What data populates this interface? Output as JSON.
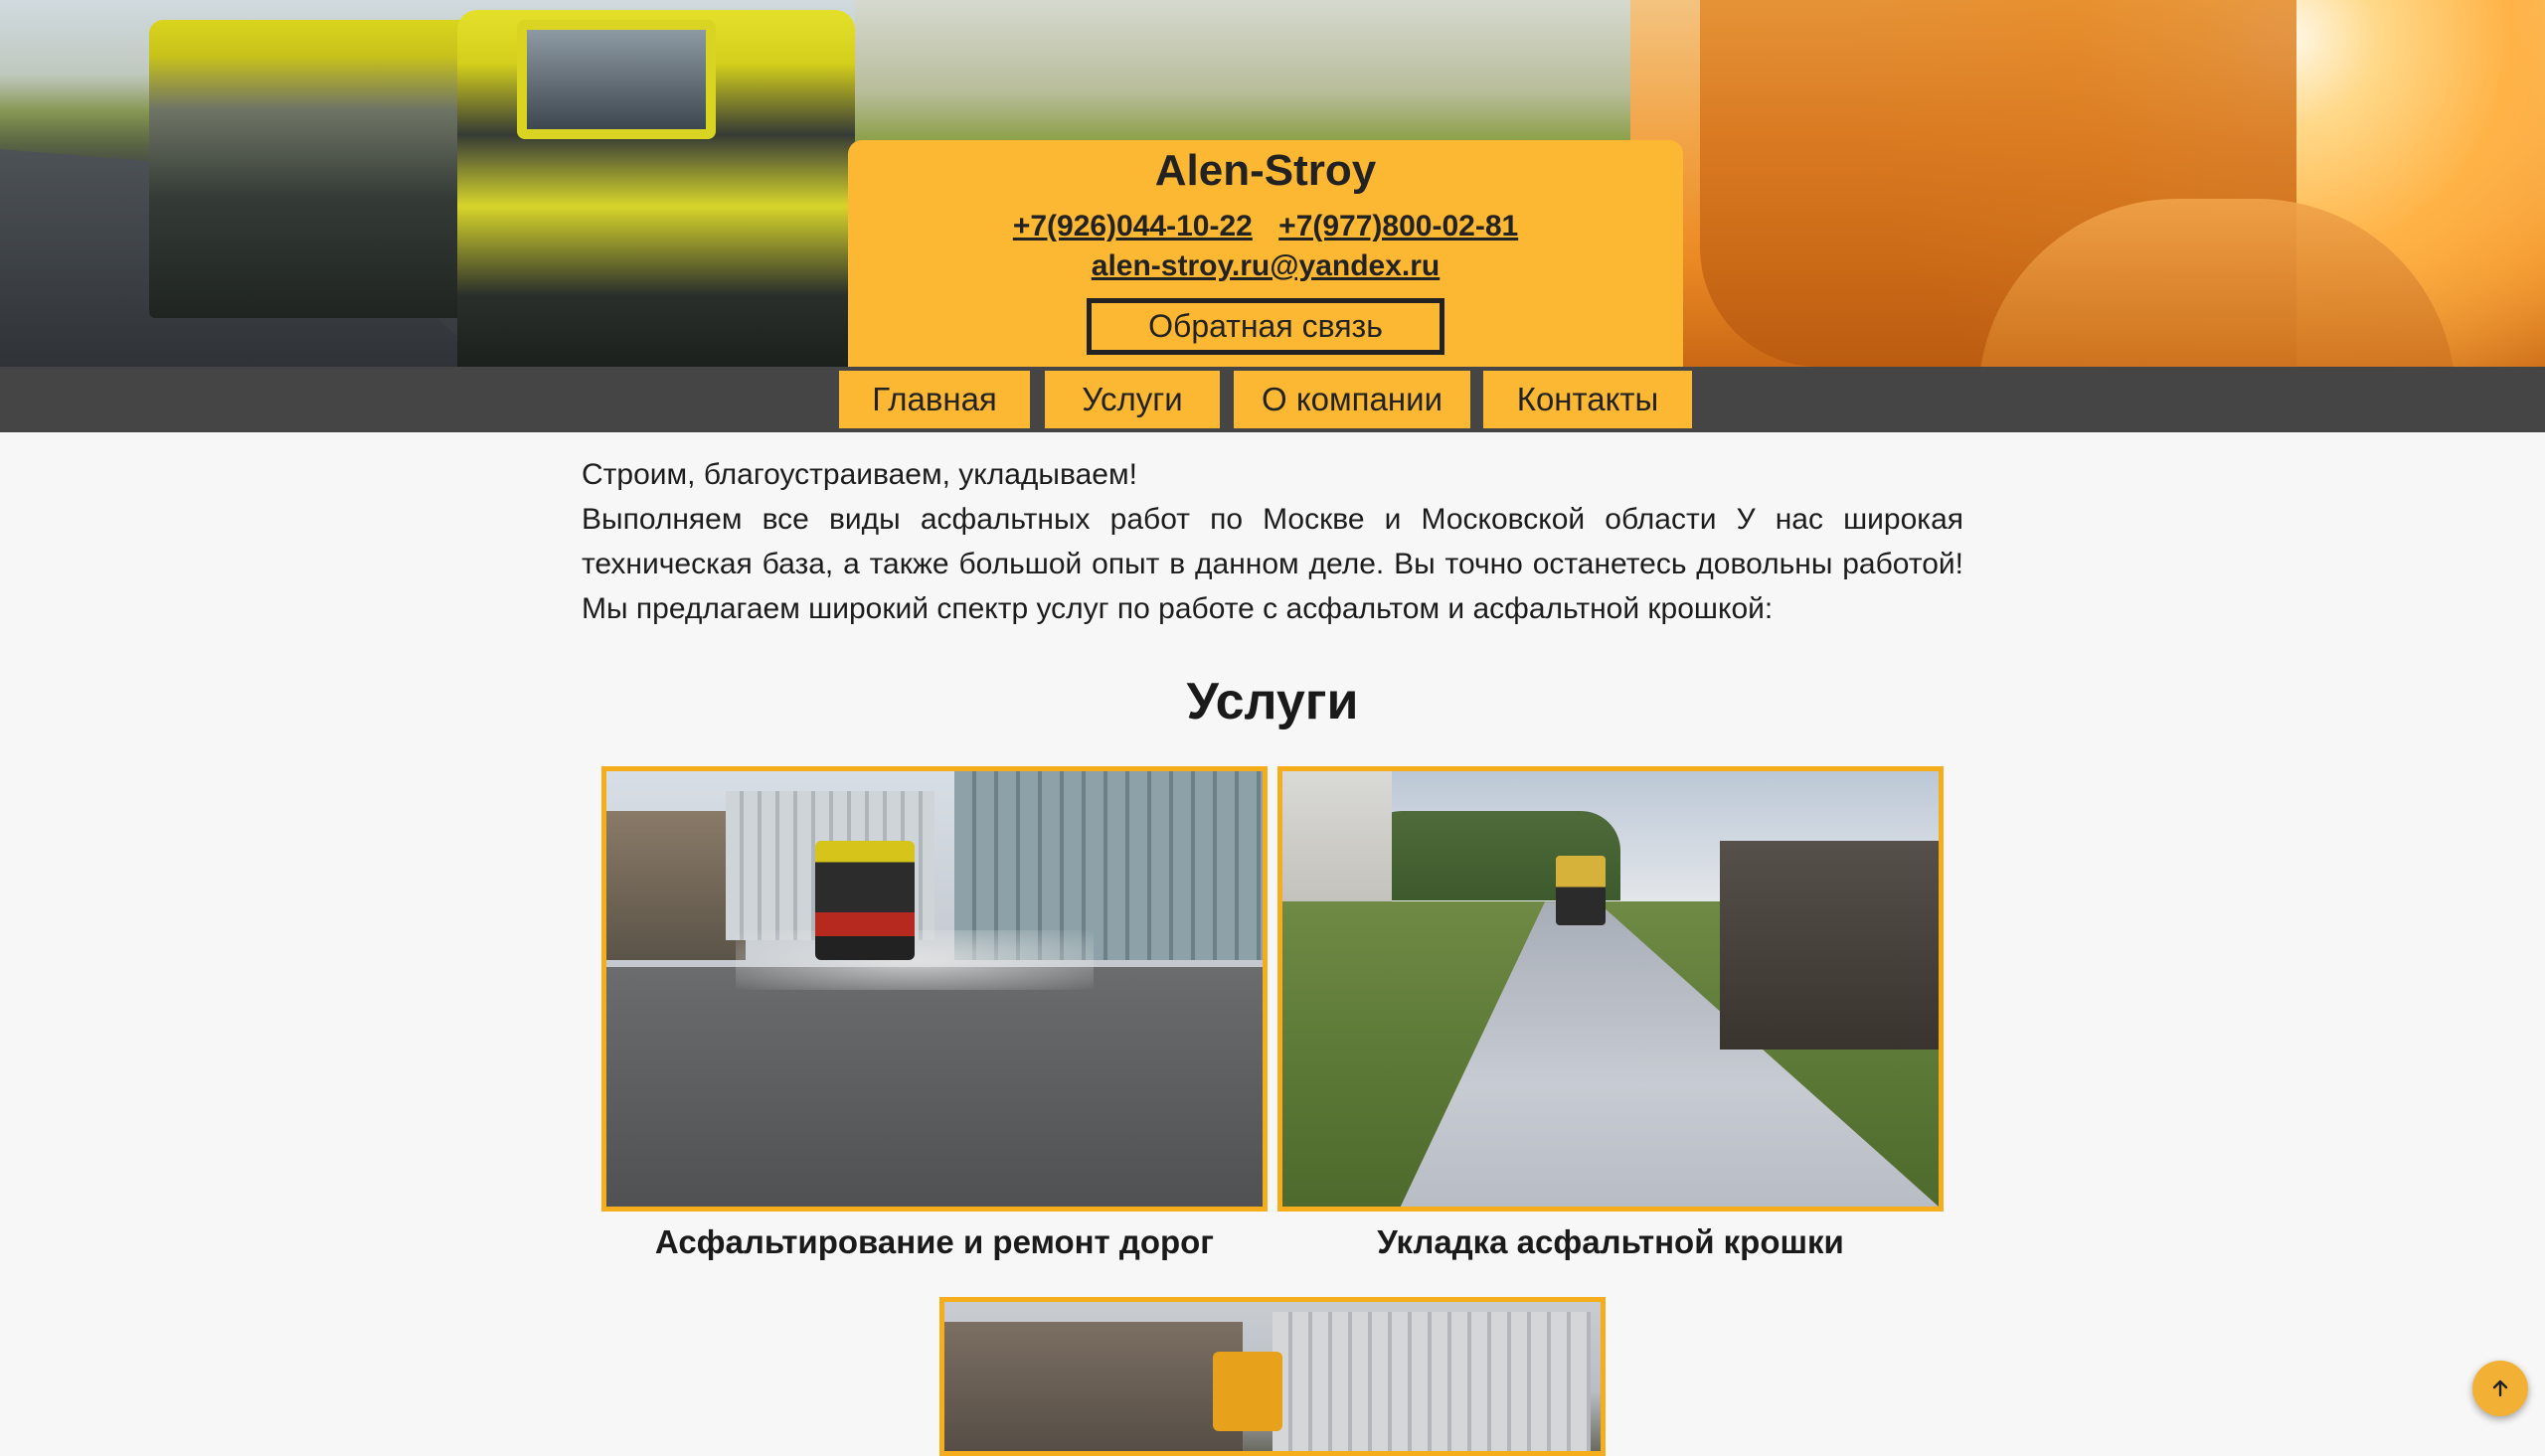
{
  "header": {
    "brand": "Alen-Stroy",
    "phone_1": "+7(926)044-10-22",
    "phone_2": "+7(977)800-02-81",
    "email": "alen-stroy.ru@yandex.ru",
    "feedback_button": "Обратная связь"
  },
  "nav": {
    "items": [
      {
        "label": "Главная"
      },
      {
        "label": "Услуги"
      },
      {
        "label": "О компании"
      },
      {
        "label": "Контакты"
      }
    ]
  },
  "intro": {
    "headline": "Строим, благоустраиваем, укладываем!",
    "body": "Выполняем все виды асфальтных работ по Москве и Московской области У нас широкая техническая база, а также большой опыт в данном деле. Вы точно останетесь довольны работой! Мы предлагаем широкий спектр услуг по работе с асфальтом и асфальтной крошкой:"
  },
  "services": {
    "title": "Услуги",
    "items": [
      {
        "caption": "Асфальтирование и ремонт дорог"
      },
      {
        "caption": "Укладка асфальтной крошки"
      },
      {
        "caption": ""
      }
    ]
  },
  "colors": {
    "accent": "#fcb832",
    "nav_bar": "#454545",
    "frame": "#f6ad1b",
    "background": "#f7f7f7"
  },
  "icons": {
    "scroll_top": "arrow-up-icon"
  }
}
